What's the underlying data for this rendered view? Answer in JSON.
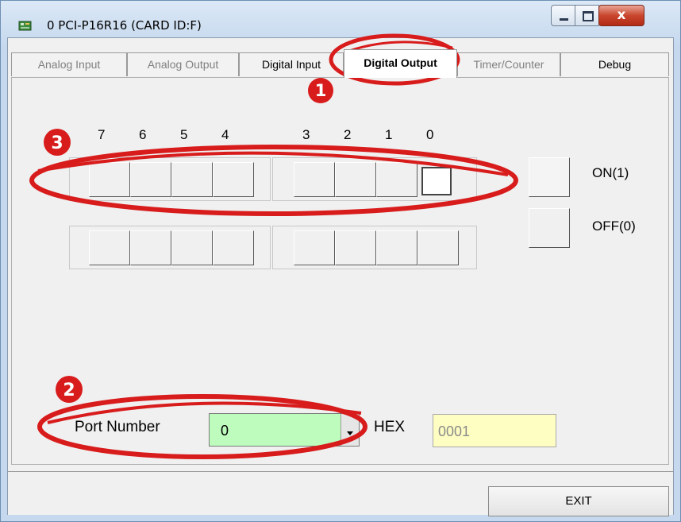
{
  "window": {
    "title": "0 PCI-P16R16 (CARD ID:F)"
  },
  "tabs": [
    {
      "label": "Analog Input"
    },
    {
      "label": "Analog Output"
    },
    {
      "label": "Digital Input"
    },
    {
      "label": "Digital Output"
    },
    {
      "label": "Timer/Counter"
    },
    {
      "label": "Debug"
    }
  ],
  "bit_labels": [
    "7",
    "6",
    "5",
    "4",
    "3",
    "2",
    "1",
    "0"
  ],
  "legend": {
    "on": "ON(1)",
    "off": "OFF(0)"
  },
  "port": {
    "label": "Port Number",
    "value": "0"
  },
  "hex": {
    "label": "HEX",
    "value": "0001"
  },
  "exit_label": "EXIT",
  "annotations": {
    "badge1": "1",
    "badge2": "2",
    "badge3": "3"
  },
  "colors": {
    "annotation_red": "#d81c1c",
    "port_combo_bg": "#bdfcbd",
    "hex_field_bg": "#fefec2"
  },
  "icons": [
    "app-card-icon",
    "minimize-icon",
    "maximize-icon",
    "close-icon",
    "dropdown-arrow-icon"
  ]
}
